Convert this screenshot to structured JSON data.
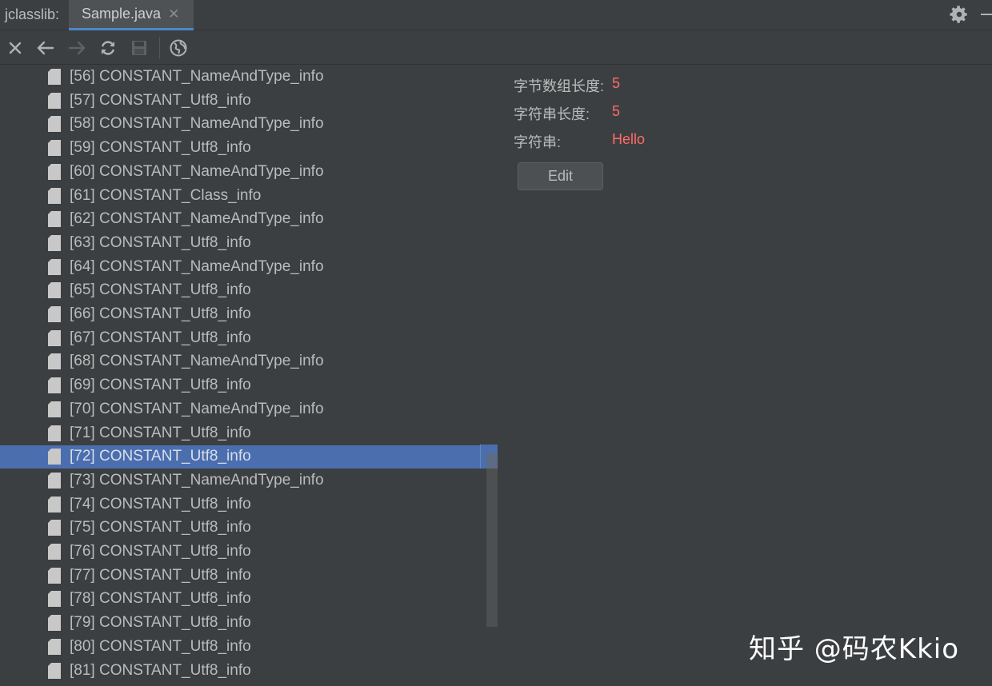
{
  "titlebar": {
    "app_label": "jclasslib:",
    "tab_label": "Sample.java",
    "tab_close": "✕"
  },
  "toolbar": {
    "icons": [
      "close-icon",
      "back-arrow-icon",
      "forward-arrow-icon",
      "refresh-icon",
      "save-icon",
      "web-icon"
    ]
  },
  "tree": {
    "items": [
      "[56] CONSTANT_NameAndType_info",
      "[57] CONSTANT_Utf8_info",
      "[58] CONSTANT_NameAndType_info",
      "[59] CONSTANT_Utf8_info",
      "[60] CONSTANT_NameAndType_info",
      "[61] CONSTANT_Class_info",
      "[62] CONSTANT_NameAndType_info",
      "[63] CONSTANT_Utf8_info",
      "[64] CONSTANT_NameAndType_info",
      "[65] CONSTANT_Utf8_info",
      "[66] CONSTANT_Utf8_info",
      "[67] CONSTANT_Utf8_info",
      "[68] CONSTANT_NameAndType_info",
      "[69] CONSTANT_Utf8_info",
      "[70] CONSTANT_NameAndType_info",
      "[71] CONSTANT_Utf8_info",
      "[72] CONSTANT_Utf8_info",
      "[73] CONSTANT_NameAndType_info",
      "[74] CONSTANT_Utf8_info",
      "[75] CONSTANT_Utf8_info",
      "[76] CONSTANT_Utf8_info",
      "[77] CONSTANT_Utf8_info",
      "[78] CONSTANT_Utf8_info",
      "[79] CONSTANT_Utf8_info",
      "[80] CONSTANT_Utf8_info",
      "[81] CONSTANT_Utf8_info"
    ],
    "selected_label": "[72] CONSTANT_Utf8_info"
  },
  "detail": {
    "byte_length_label": "字节数组长度:",
    "byte_length_value": "5",
    "string_length_label": "字符串长度:",
    "string_length_value": "5",
    "string_label": "字符串:",
    "string_value": "Hello",
    "edit_label": "Edit"
  },
  "watermark": "知乎 @码农Kkio",
  "colors": {
    "background": "#3c3f41",
    "selection": "#4b6eaf",
    "value_red": "#ff6b68",
    "tab_underline": "#4a88c7"
  }
}
